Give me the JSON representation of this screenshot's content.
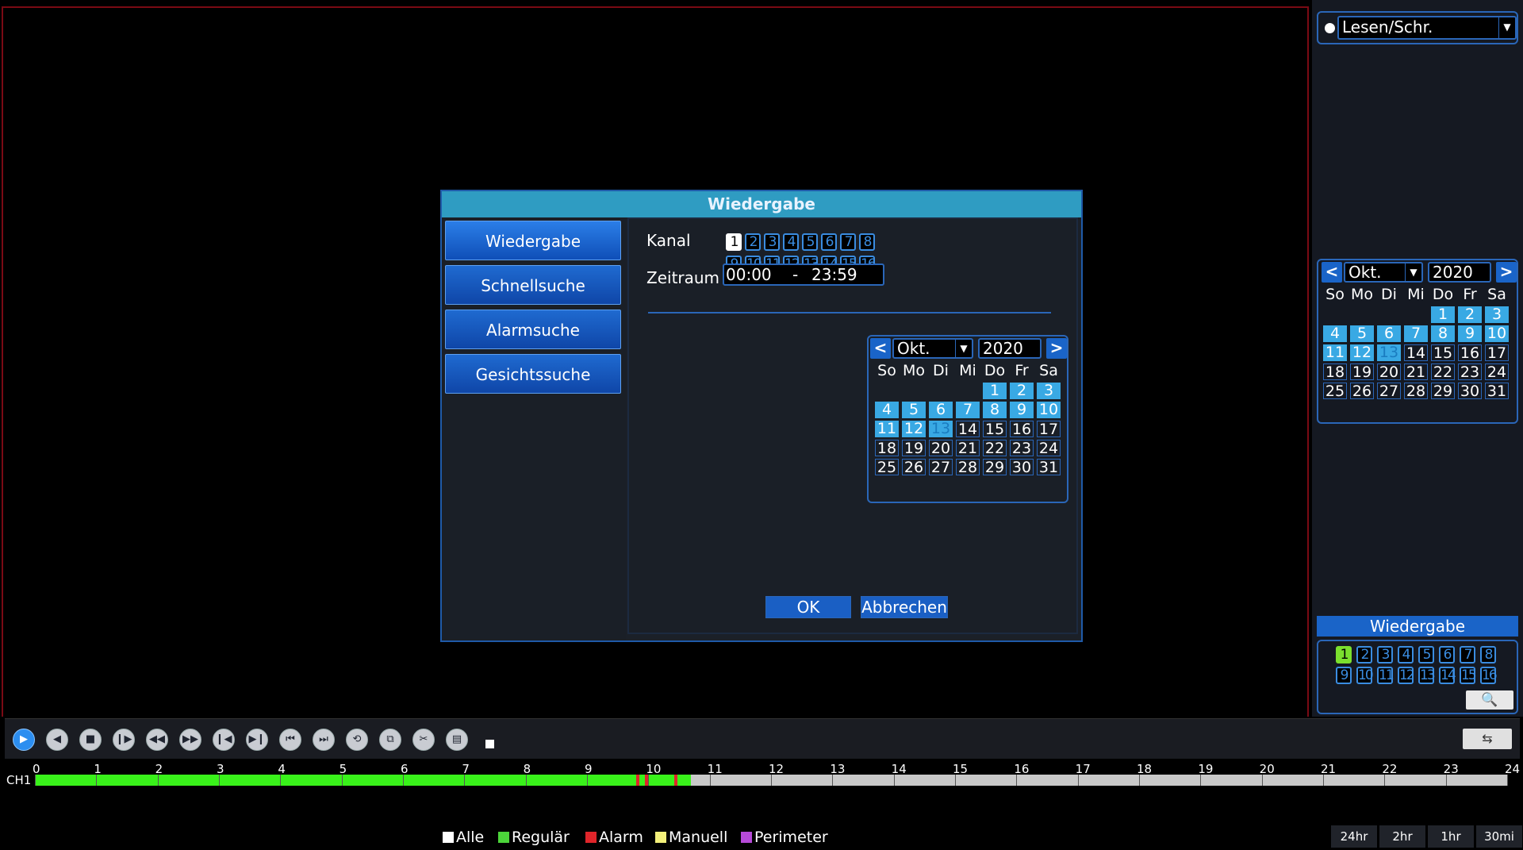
{
  "dialog": {
    "title": "Wiedergabe",
    "nav": [
      "Wiedergabe",
      "Schnellsuche",
      "Alarmsuche",
      "Gesichtssuche"
    ],
    "kanal_label": "Kanal",
    "zeitraum_label": "Zeitraum",
    "time_start": "00:00",
    "time_sep": "-",
    "time_end": "23:59",
    "ok": "OK",
    "cancel": "Abbrechen",
    "calendar": {
      "prev": "<",
      "next": ">",
      "month": "Okt.",
      "year": "2020"
    }
  },
  "channels": [
    "1",
    "2",
    "3",
    "4",
    "5",
    "6",
    "7",
    "8",
    "9",
    "10",
    "11",
    "12",
    "13",
    "14",
    "15",
    "16"
  ],
  "weekdays": [
    "So",
    "Mo",
    "Di",
    "Mi",
    "Do",
    "Fr",
    "Sa"
  ],
  "days": [
    "1",
    "2",
    "3",
    "4",
    "5",
    "6",
    "7",
    "8",
    "9",
    "10",
    "11",
    "12",
    "13",
    "14",
    "15",
    "16",
    "17",
    "18",
    "19",
    "20",
    "21",
    "22",
    "23",
    "24",
    "25",
    "26",
    "27",
    "28",
    "29",
    "30",
    "31"
  ],
  "right_panel": {
    "mode": "Lesen/Schr.",
    "calendar": {
      "prev": "<",
      "next": ">",
      "month": "Okt.",
      "year": "2020"
    },
    "playback_label": "Wiedergabe"
  },
  "timeline": {
    "channel": "CH1",
    "hours": [
      "0",
      "1",
      "2",
      "3",
      "4",
      "5",
      "6",
      "7",
      "8",
      "9",
      "10",
      "11",
      "12",
      "13",
      "14",
      "15",
      "16",
      "17",
      "18",
      "19",
      "20",
      "21",
      "22",
      "23",
      "24"
    ]
  },
  "legend": [
    "Alle",
    "Regulär",
    "Alarm",
    "Manuell",
    "Perimeter"
  ],
  "legend_colors": [
    "#ffffff",
    "#4cd43a",
    "#e0252a",
    "#f3f07a",
    "#b64ad8"
  ],
  "zoom": [
    "24hr",
    "2hr",
    "1hr",
    "30mi"
  ],
  "colors": {
    "accent": "#2f9cc2",
    "record": "#39a9e4",
    "regular": "#39f21a"
  }
}
